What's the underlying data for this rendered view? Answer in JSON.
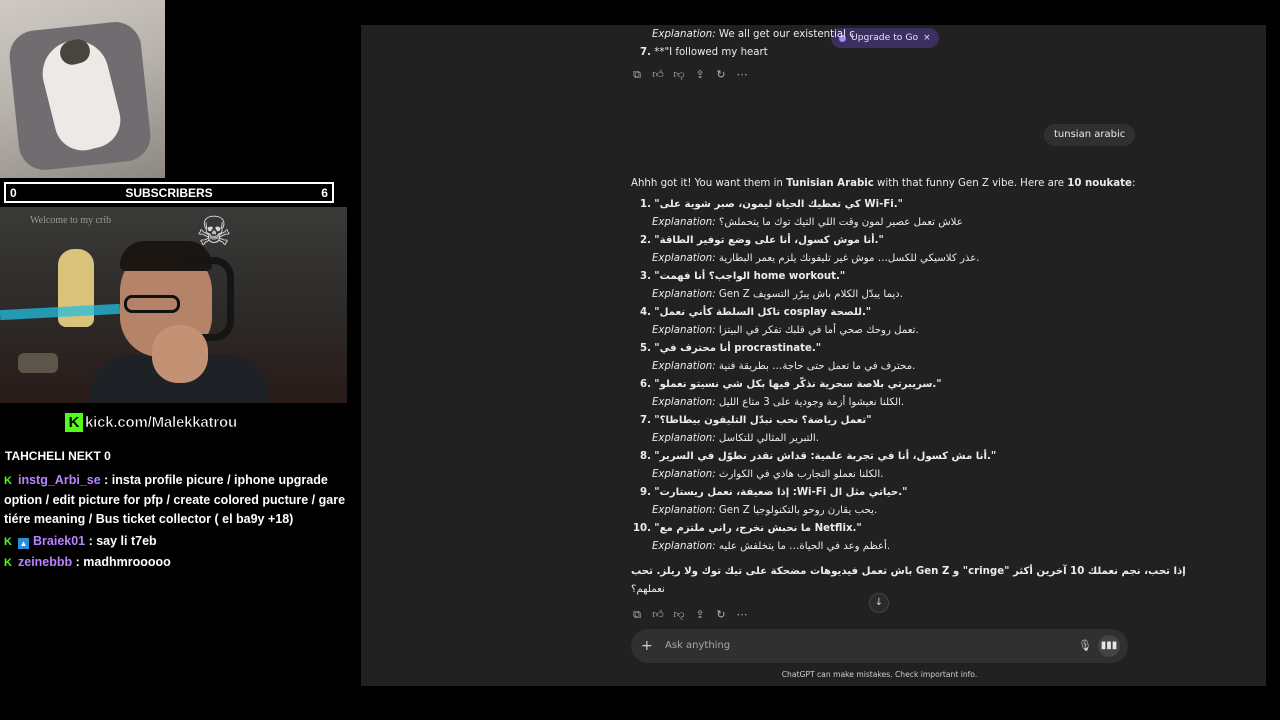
{
  "overlay": {
    "subscribers": {
      "left": "0",
      "label": "SUBSCRIBERS",
      "right": "6"
    },
    "wall_text": "Welcome to my crib",
    "kick_url": "kick.com/Malekkatrou",
    "ticker": "TAHCHELI NEKT 0",
    "chat": [
      {
        "user": "instg_Arbi_se",
        "color": "purple",
        "badges": [
          "kick"
        ],
        "text": " : insta profile picure / iphone upgrade option / edit picture for pfp / create colored pucture / gare tiére meaning / Bus ticket collector ( el ba9y +18)"
      },
      {
        "user": "Braiek01",
        "color": "purple",
        "badges": [
          "kick",
          "sub"
        ],
        "text": " : say li t7eb"
      },
      {
        "user": "zeinebbb",
        "color": "purple",
        "badges": [
          "kick"
        ],
        "text": " : madhmrooooo"
      }
    ]
  },
  "gpt": {
    "upgrade_label": "Upgrade to Go",
    "upgrade_close": "×",
    "top_expl": {
      "label": "Explanation:",
      "text": " We all get our existential c"
    },
    "top_item": {
      "num": "7.",
      "text": "**\"I followed my heart"
    },
    "user_message": "tunsian arabic",
    "intro": {
      "a": "Ahhh got it! You want them in ",
      "b": "Tunisian Arabic",
      "c": " with that funny Gen Z vibe. Here are ",
      "d": "10 noukate",
      "e": ":"
    },
    "items": [
      {
        "num": "1.",
        "title": "\"كي تعطيك الحياة ليمون، صبر شوية على Wi-Fi.\"",
        "expl": "علاش تعمل عصير لمون وقت اللي التيك توك ما يتحملش؟"
      },
      {
        "num": "2.",
        "title": "\"أنا موش كسول، أنا على وضع توفير الطاقة.\"",
        "expl": "عذر كلاسيكي للكسل… موش غير تليفونك يلزم يعمر البطارية."
      },
      {
        "num": "3.",
        "title": "\"الواجب؟ أنا فهمت home workout.\"",
        "expl": "Gen Z ديما يبدّل الكلام باش يبرّر التسويف."
      },
      {
        "num": "4.",
        "title": "\"تاكل السلطة كأني نعمل cosplay للصحة.\"",
        "expl": "تعمل روحك صحي أما في قلبك تفكر في البيتزا."
      },
      {
        "num": "5.",
        "title": "\"أنا محترف في procrastinate.\"",
        "expl": "محترف في ما تعمل حتى حاجة… بطريقة فنية."
      },
      {
        "num": "6.",
        "title": "\"سريبرتي بلاصة سحرية نذكّر فيها بكل شي نسيتو نعملو.\"",
        "expl": "الكلنا نعيشوا أزمة وجودية على 3 متاع الليل."
      },
      {
        "num": "7.",
        "title": "\"تعمل رياضة؟ نحب نبدّل التليفون بيطاطا؟\"",
        "expl": "التبرير المثالي للتكاسل."
      },
      {
        "num": "8.",
        "title": "\"أنا مش كسول، أنا في تجربة علمية: قداش نقدر نطوّل في السرير.\"",
        "expl": "الكلنا نعملو التجارب هاذي في الكوارث."
      },
      {
        "num": "9.",
        "title": "\"إذا ضعيفة، نعمل ريستارت :Wi-Fi حياتي مثل ال.\"",
        "expl": "Gen Z يحب يقارن روحو بالتكنولوجيا."
      },
      {
        "num": "10.",
        "title": "\"ما نحبش نخرج، راني ملتزم مع Netflix.\"",
        "expl": "أعظم وعد في الحياة… ما يتخلفش عليه."
      }
    ],
    "outro_line1": "باش تعمل فيديوهات مضحكة على تيك توك ولا ريلز. تحب Gen Z و \"cringe\" إذا تحب، نجم نعملك 10 آخرين أكثر",
    "outro_line2": "نعملهم؟",
    "composer_placeholder": "Ask anything",
    "disclaimer": "ChatGPT can make mistakes. Check important info."
  }
}
